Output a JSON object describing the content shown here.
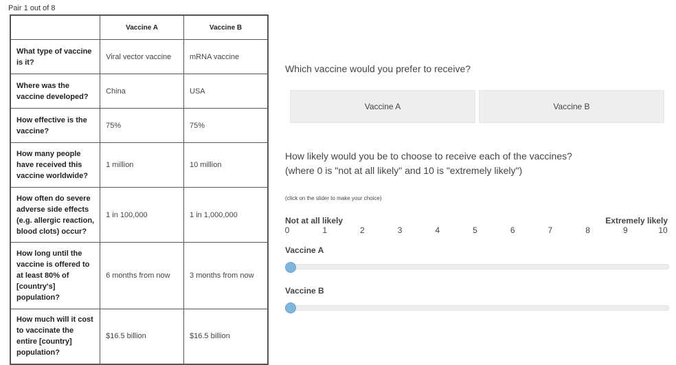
{
  "pair_label": "Pair 1 out of 8",
  "table": {
    "headers": [
      "",
      "Vaccine A",
      "Vaccine B"
    ],
    "rows": [
      {
        "q": "What type of vaccine is it?",
        "a": "Viral vector vaccine",
        "b": "mRNA vaccine"
      },
      {
        "q": "Where was the vaccine developed?",
        "a": "China",
        "b": "USA"
      },
      {
        "q": "How effective is the vaccine?",
        "a": "75%",
        "b": "75%"
      },
      {
        "q": "How many people have received this vaccine worldwide?",
        "a": "1 million",
        "b": "10 million"
      },
      {
        "q": "How often do severe adverse side effects (e.g. allergic reaction, blood clots) occur?",
        "a": "1 in 100,000",
        "b": "1 in 1,000,000"
      },
      {
        "q": "How long until the vaccine is offered to at least 80% of [country's] population?",
        "a": "6 months from now",
        "b": "3 months from now"
      },
      {
        "q": "How much will it cost to vaccinate the entire [country] population?",
        "a": "$16.5 billion",
        "b": "$16.5 billion"
      }
    ]
  },
  "question1": "Which vaccine would you prefer to receive?",
  "choices": [
    "Vaccine A",
    "Vaccine B"
  ],
  "question2_line1": "How likely would you be to choose to receive each of the vaccines?",
  "question2_line2": "(where 0 is \"not at all likely\" and 10 is \"extremely likely\")",
  "slider_instruction": "(click on the slider to make your choice)",
  "scale": {
    "min_label": "Not at all likely",
    "max_label": "Extremely likely",
    "ticks": [
      "0",
      "1",
      "2",
      "3",
      "4",
      "5",
      "6",
      "7",
      "8",
      "9",
      "10"
    ]
  },
  "sliders": [
    {
      "label": "Vaccine A",
      "value": 0
    },
    {
      "label": "Vaccine B",
      "value": 0
    }
  ],
  "colors": {
    "handle": "#7fb6dc",
    "track": "#ededed",
    "button_bg": "#eeeeee"
  }
}
